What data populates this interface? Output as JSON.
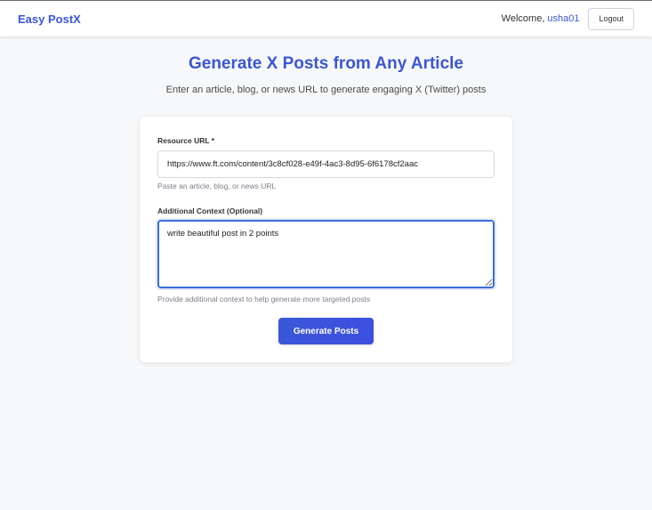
{
  "header": {
    "brand": "Easy PostX",
    "welcome_text": "Welcome,",
    "username": "usha01",
    "logout_label": "Logout"
  },
  "hero": {
    "title": "Generate X Posts from Any Article",
    "subtitle": "Enter an article, blog, or news URL to generate engaging X (Twitter) posts"
  },
  "form": {
    "url_label": "Resource URL *",
    "url_value": "https://www.ft.com/content/3c8cf028-e49f-4ac3-8d95-6f6178cf2aac",
    "url_help": "Paste an article, blog, or news URL",
    "context_label": "Additional Context (Optional)",
    "context_value": "write beautiful post in 2 points",
    "context_help": "Provide additional context to help generate more targeted posts",
    "submit_label": "Generate Posts"
  },
  "colors": {
    "accent": "#3b56d4",
    "focus_border": "#3b6fd8",
    "page_background": "#f7f8fa"
  }
}
